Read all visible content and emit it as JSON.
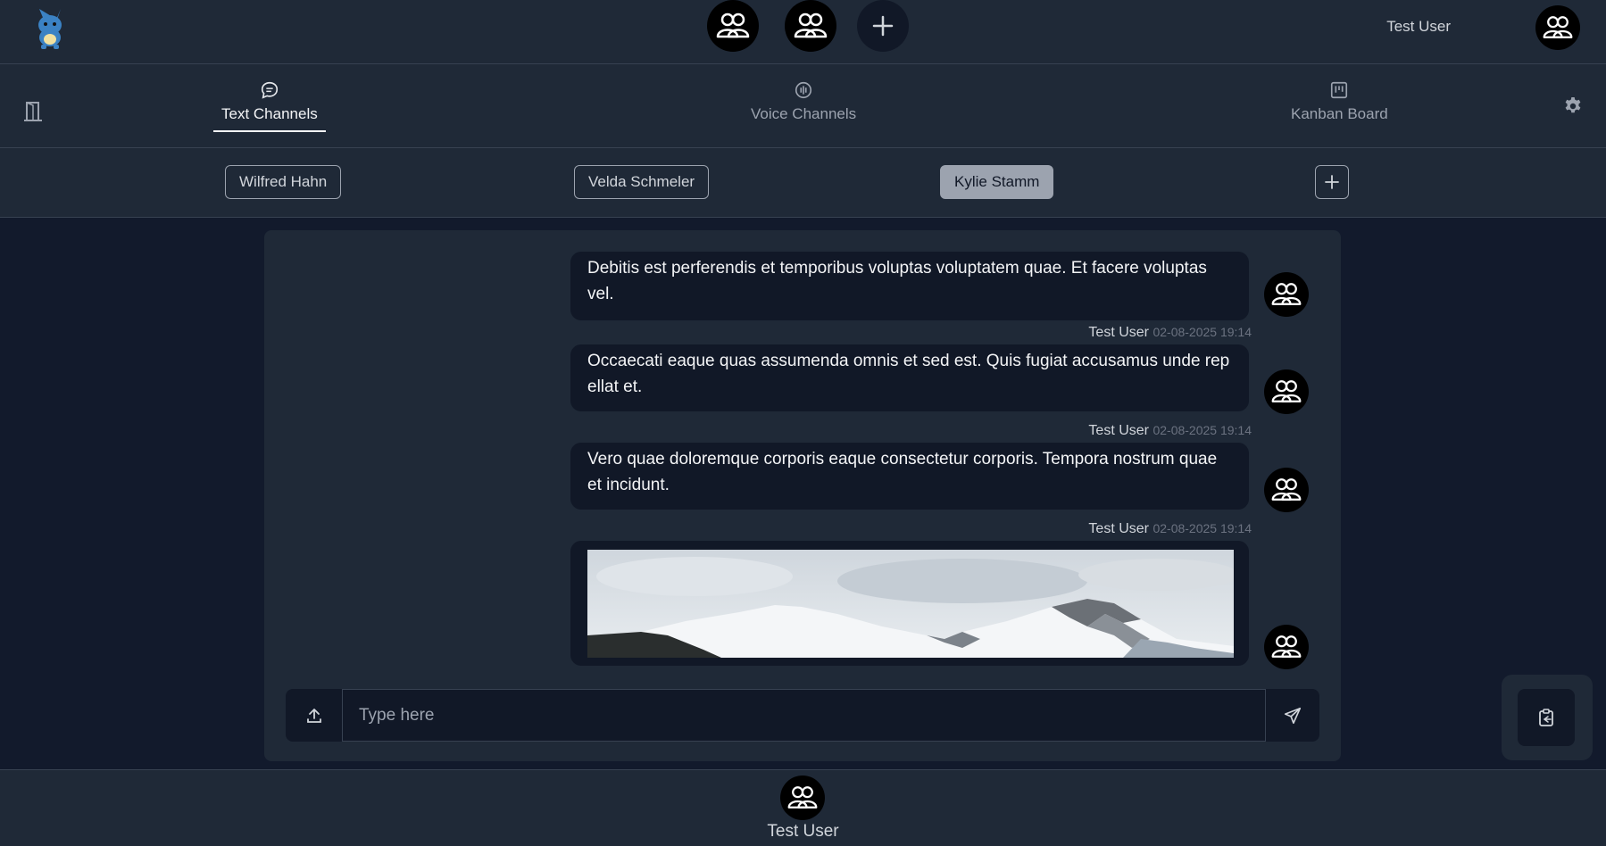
{
  "header": {
    "servers": [
      "group-avatar",
      "group-avatar"
    ],
    "add_server_icon": "plus-icon",
    "user_name": "Test User"
  },
  "nav": {
    "tabs": [
      {
        "label": "Text Channels",
        "icon": "chat-bubble-icon",
        "active": true
      },
      {
        "label": "Voice Channels",
        "icon": "voice-icon",
        "active": false
      },
      {
        "label": "Kanban Board",
        "icon": "kanban-icon",
        "active": false
      }
    ]
  },
  "channels": {
    "items": [
      {
        "label": "Wilfred Hahn",
        "active": false
      },
      {
        "label": "Velda Schmeler",
        "active": false
      },
      {
        "label": "Kylie Stamm",
        "active": true
      }
    ]
  },
  "messages": [
    {
      "text": "Debitis est perferendis et temporibus voluptas voluptatem quae. Et facere voluptas vel."
    },
    {
      "author": "Test User",
      "timestamp": "02-08-2025 19:14",
      "text": "Occaecati eaque quas assumenda omnis et sed est. Quis fugiat accusamus unde rep ellat et."
    },
    {
      "author": "Test User",
      "timestamp": "02-08-2025 19:14",
      "text": "Vero quae doloremque corporis eaque consectetur corporis. Tempora nostrum quae et incidunt."
    },
    {
      "author": "Test User",
      "timestamp": "02-08-2025 19:14",
      "type": "image"
    }
  ],
  "composer": {
    "placeholder": "Type here"
  },
  "footer": {
    "user_name": "Test User"
  },
  "colors": {
    "background": "#121a2c",
    "panel": "#1f2937",
    "bubble": "#111827",
    "active_channel": "#9ca3af"
  }
}
